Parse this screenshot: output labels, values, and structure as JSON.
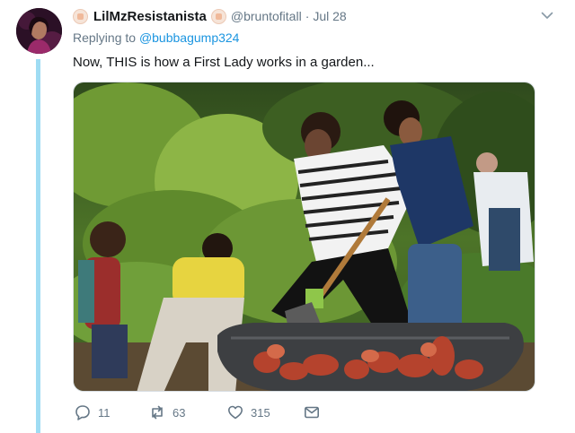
{
  "tweet": {
    "display_name": "LilMzResistanista",
    "handle": "@bruntofitall",
    "separator": "·",
    "date": "Jul 28",
    "reply_prefix": "Replying to",
    "reply_to": "@bubbagump324",
    "text": "Now, THIS is how a First Lady works in a garden..."
  },
  "actions": {
    "replies": "11",
    "retweets": "63",
    "likes": "315"
  },
  "icons": [
    "chevron-down-icon",
    "reply-icon",
    "retweet-icon",
    "like-icon",
    "message-icon"
  ],
  "colors": {
    "accent": "#1b95e0",
    "muted": "#657786",
    "thread_line": "#9fdcf3"
  }
}
